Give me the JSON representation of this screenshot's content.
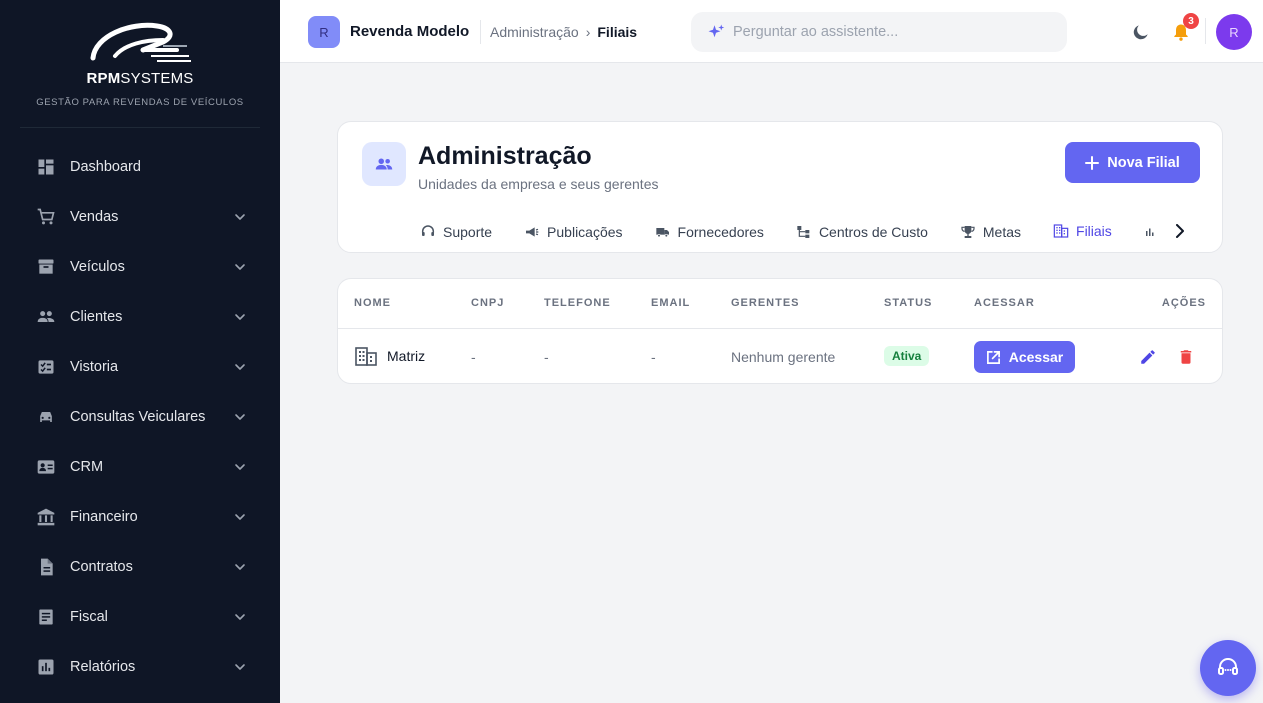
{
  "brand": {
    "name_bold": "RPM",
    "name_rest": "SYSTEMS",
    "tagline": "GESTÃO PARA REVENDAS DE VEÍCULOS"
  },
  "sidebar": {
    "items": [
      {
        "label": "Dashboard",
        "icon": "dashboard-icon",
        "has_submenu": false
      },
      {
        "label": "Vendas",
        "icon": "cart-icon",
        "has_submenu": true
      },
      {
        "label": "Veículos",
        "icon": "archive-icon",
        "has_submenu": true
      },
      {
        "label": "Clientes",
        "icon": "people-icon",
        "has_submenu": true
      },
      {
        "label": "Vistoria",
        "icon": "checklist-icon",
        "has_submenu": true
      },
      {
        "label": "Consultas Veiculares",
        "icon": "car-icon",
        "has_submenu": true
      },
      {
        "label": "CRM",
        "icon": "contact-card-icon",
        "has_submenu": true
      },
      {
        "label": "Financeiro",
        "icon": "bank-icon",
        "has_submenu": true
      },
      {
        "label": "Contratos",
        "icon": "document-icon",
        "has_submenu": true
      },
      {
        "label": "Fiscal",
        "icon": "receipt-icon",
        "has_submenu": true
      },
      {
        "label": "Relatórios",
        "icon": "bar-chart-icon",
        "has_submenu": true
      }
    ]
  },
  "topbar": {
    "company_initial": "R",
    "company_name": "Revenda Modelo",
    "breadcrumb": {
      "parent": "Administração",
      "separator": "›",
      "current": "Filiais"
    },
    "assistant_placeholder": "Perguntar ao assistente...",
    "notification_count": "3",
    "user_initial": "R"
  },
  "header": {
    "title": "Administração",
    "subtitle": "Unidades da empresa e seus gerentes",
    "new_button": "Nova Filial"
  },
  "tabs": [
    {
      "label": "Suporte",
      "icon": "headset-icon",
      "active": false
    },
    {
      "label": "Publicações",
      "icon": "megaphone-icon",
      "active": false
    },
    {
      "label": "Fornecedores",
      "icon": "truck-icon",
      "active": false
    },
    {
      "label": "Centros de Custo",
      "icon": "hierarchy-icon",
      "active": false
    },
    {
      "label": "Metas",
      "icon": "trophy-icon",
      "active": false
    },
    {
      "label": "Filiais",
      "icon": "building-icon",
      "active": true
    }
  ],
  "table": {
    "columns": [
      "NOME",
      "CNPJ",
      "TELEFONE",
      "EMAIL",
      "GERENTES",
      "STATUS",
      "ACESSAR",
      "AÇÕES"
    ],
    "rows": [
      {
        "nome": "Matriz",
        "cnpj": "-",
        "telefone": "-",
        "email": "-",
        "gerentes": "Nenhum gerente",
        "status": "Ativa",
        "acessar": "Acessar"
      }
    ]
  },
  "colors": {
    "accent": "#6366f1",
    "sidebar_bg": "#0f1626",
    "status_green_bg": "#dcfce7",
    "status_green_text": "#15803d",
    "delete_red": "#ef4444",
    "badge_red": "#ef4444"
  }
}
